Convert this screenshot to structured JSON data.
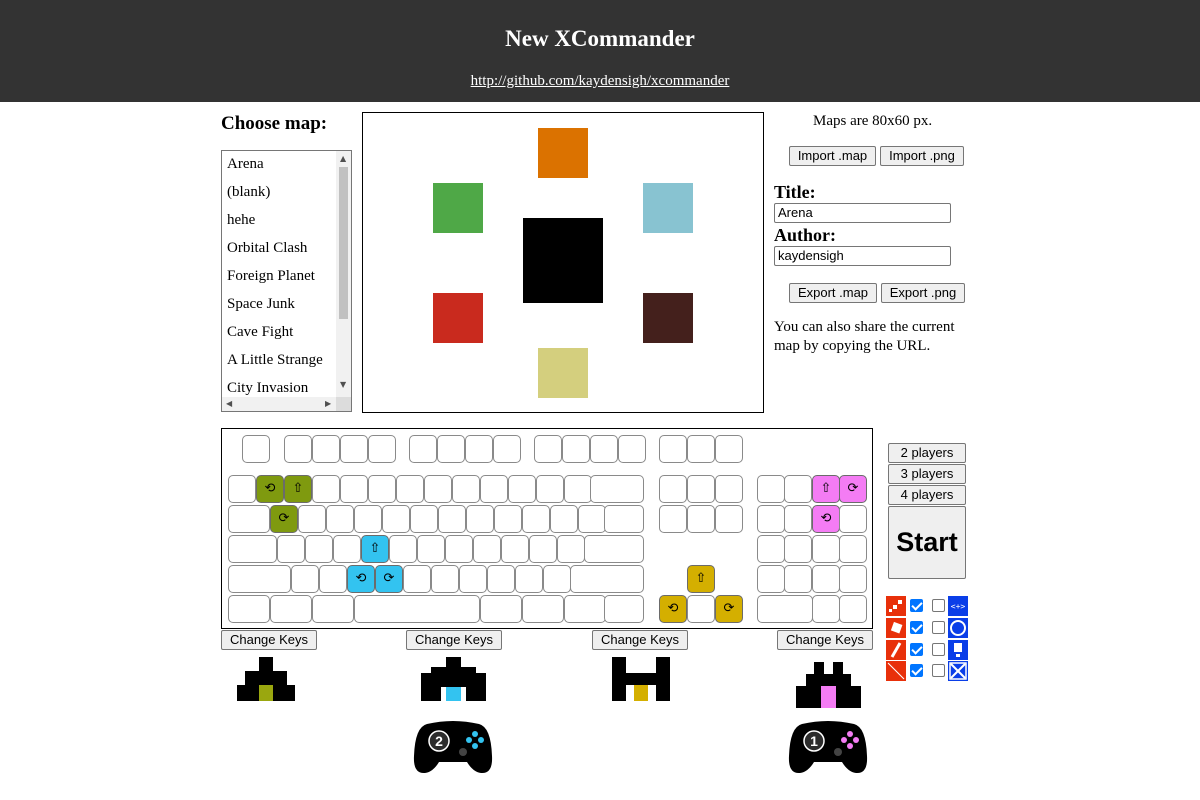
{
  "header": {
    "title": "New XCommander",
    "link": "http://github.com/kaydensigh/xcommander"
  },
  "maps": {
    "label": "Choose map:",
    "items": [
      "Arena",
      "(blank)",
      "hehe",
      "Orbital Clash",
      "Foreign Planet",
      "Space Junk",
      "Cave Fight",
      "A Little Strange",
      "City Invasion"
    ],
    "selected": "Arena"
  },
  "side": {
    "size_note": "Maps are 80x60 px.",
    "import_map": "Import .map",
    "import_png": "Import .png",
    "title_label": "Title:",
    "title_value": "Arena",
    "author_label": "Author:",
    "author_value": "kaydensigh",
    "export_map": "Export .map",
    "export_png": "Export .png",
    "share_note": "You can also share the current map by copying the URL."
  },
  "players": {
    "two": "2 players",
    "three": "3 players",
    "four": "4 players",
    "start": "Start",
    "change_keys": [
      "Change Keys",
      "Change Keys",
      "Change Keys",
      "Change Keys"
    ]
  },
  "controllers": [
    "2",
    "1"
  ],
  "colors": {
    "green": "#7f9a0f",
    "cyan": "#33c3f0",
    "yellow": "#d4af00",
    "pink": "#f47cf4",
    "orange": "#db7200",
    "map_green": "#4fa847",
    "map_lightblue": "#88c3d1",
    "map_red": "#c92a1e",
    "map_brown": "#44201c",
    "map_khaki": "#d4cf7e",
    "option_red": "#e8300a",
    "option_blue": "#0a3ee8"
  },
  "key_glyphs": {
    "thrust": "⇧",
    "left": "⟲",
    "right": "⟳"
  },
  "options": [
    {
      "left_checked": true,
      "right_checked": false,
      "left_icon": "scatter-icon",
      "right_icon": "code-icon"
    },
    {
      "left_checked": true,
      "right_checked": false,
      "left_icon": "diamond-icon",
      "right_icon": "circle-icon"
    },
    {
      "left_checked": true,
      "right_checked": false,
      "left_icon": "slash-icon",
      "right_icon": "exclamation-icon"
    },
    {
      "left_checked": true,
      "right_checked": false,
      "left_icon": "diagonal-icon",
      "right_icon": "cross-icon"
    }
  ]
}
